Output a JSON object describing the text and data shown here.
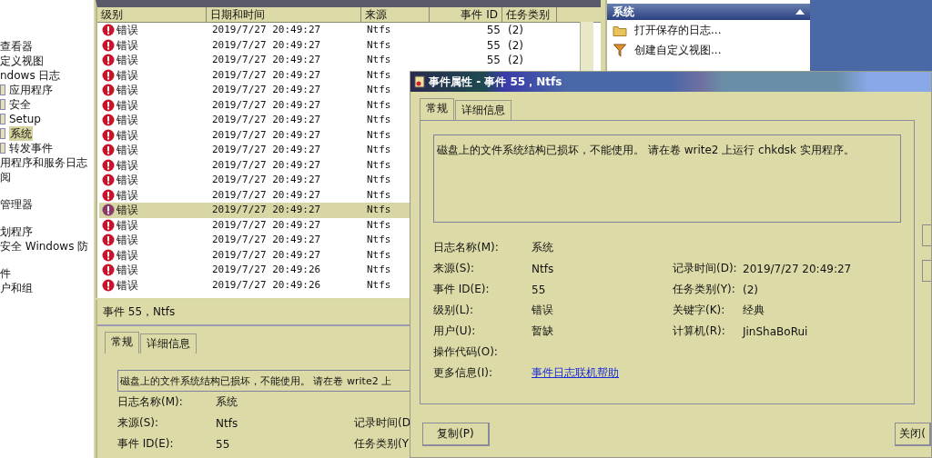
{
  "tree": {
    "sections": [
      [
        {
          "label": "查看器",
          "selected": false
        },
        {
          "label": "定义视图",
          "selected": false
        },
        {
          "label": "ndows 日志",
          "selected": false,
          "children": [
            {
              "label": "应用程序",
              "selected": false
            },
            {
              "label": "安全",
              "selected": false
            },
            {
              "label": "Setup",
              "selected": false
            },
            {
              "label": "系统",
              "selected": true
            },
            {
              "label": "转发事件",
              "selected": false
            }
          ]
        },
        {
          "label": "用程序和服务日志",
          "selected": false
        },
        {
          "label": "阅",
          "selected": false
        }
      ],
      [
        {
          "label": "管理器",
          "selected": false
        }
      ],
      [
        {
          "label": "划程序",
          "selected": false
        },
        {
          "label": "安全 Windows 防",
          "selected": false
        }
      ],
      [
        {
          "label": "件",
          "selected": false
        },
        {
          "label": "户和组",
          "selected": false
        }
      ]
    ]
  },
  "event_list": {
    "columns": [
      "级别",
      "日期和时间",
      "来源",
      "事件 ID",
      "任务类别"
    ],
    "rows": [
      {
        "level": "错误",
        "datetime": "2019/7/27 20:49:27",
        "source": "Ntfs",
        "event_id": "55",
        "task": "(2)",
        "selected": false
      },
      {
        "level": "错误",
        "datetime": "2019/7/27 20:49:27",
        "source": "Ntfs",
        "event_id": "55",
        "task": "(2)",
        "selected": false
      },
      {
        "level": "错误",
        "datetime": "2019/7/27 20:49:27",
        "source": "Ntfs",
        "event_id": "55",
        "task": "(2)",
        "selected": false
      },
      {
        "level": "错误",
        "datetime": "2019/7/27 20:49:27",
        "source": "Ntfs",
        "selected": false
      },
      {
        "level": "错误",
        "datetime": "2019/7/27 20:49:27",
        "source": "Ntfs",
        "selected": false
      },
      {
        "level": "错误",
        "datetime": "2019/7/27 20:49:27",
        "source": "Ntfs",
        "selected": false
      },
      {
        "level": "错误",
        "datetime": "2019/7/27 20:49:27",
        "source": "Ntfs",
        "selected": false
      },
      {
        "level": "错误",
        "datetime": "2019/7/27 20:49:27",
        "source": "Ntfs",
        "selected": false
      },
      {
        "level": "错误",
        "datetime": "2019/7/27 20:49:27",
        "source": "Ntfs",
        "selected": false
      },
      {
        "level": "错误",
        "datetime": "2019/7/27 20:49:27",
        "source": "Ntfs",
        "selected": false
      },
      {
        "level": "错误",
        "datetime": "2019/7/27 20:49:27",
        "source": "Ntfs",
        "selected": false
      },
      {
        "level": "错误",
        "datetime": "2019/7/27 20:49:27",
        "source": "Ntfs",
        "selected": false
      },
      {
        "level": "错误",
        "datetime": "2019/7/27 20:49:27",
        "source": "Ntfs",
        "selected": true
      },
      {
        "level": "错误",
        "datetime": "2019/7/27 20:49:27",
        "source": "Ntfs",
        "selected": false
      },
      {
        "level": "错误",
        "datetime": "2019/7/27 20:49:27",
        "source": "Ntfs",
        "selected": false
      },
      {
        "level": "错误",
        "datetime": "2019/7/27 20:49:27",
        "source": "Ntfs",
        "selected": false
      },
      {
        "level": "错误",
        "datetime": "2019/7/27 20:49:26",
        "source": "Ntfs",
        "selected": false
      },
      {
        "level": "错误",
        "datetime": "2019/7/27 20:49:26",
        "source": "Ntfs",
        "selected": false
      }
    ]
  },
  "actions": {
    "title": "系统",
    "items": [
      {
        "label": "打开保存的日志...",
        "kind": "folder"
      },
      {
        "label": "创建自定义视图...",
        "kind": "filter"
      }
    ]
  },
  "preview": {
    "title": "事件 55，Ntfs",
    "tabs": [
      {
        "label": "常规",
        "selected": true
      },
      {
        "label": "详细信息",
        "selected": false
      }
    ],
    "message": "磁盘上的文件系统结构已损坏，不能使用。 请在卷 write2 上",
    "fields": [
      {
        "label": "日志名称(M):",
        "value": "系统"
      },
      {
        "label": "来源(S):",
        "value": "Ntfs",
        "label2": "记录时间(D"
      },
      {
        "label": "事件 ID(E):",
        "value": "55",
        "label2": "任务类别(Y"
      }
    ]
  },
  "dialog": {
    "title": "事件属性 - 事件 55，Ntfs",
    "tabs": [
      {
        "label": "常规",
        "selected": true
      },
      {
        "label": "详细信息",
        "selected": false
      }
    ],
    "message": "磁盘上的文件系统结构已损坏，不能使用。 请在卷 write2 上运行 chkdsk 实用程序。",
    "fields": [
      {
        "label": "日志名称(M):",
        "value": "系统"
      },
      {
        "label": "来源(S):",
        "value": "Ntfs",
        "label2": "记录时间(D):",
        "value2": "2019/7/27 20:49:27"
      },
      {
        "label": "事件 ID(E):",
        "value": "55",
        "label2": "任务类别(Y):",
        "value2": "(2)"
      },
      {
        "label": "级别(L):",
        "value": "错误",
        "label2": "关键字(K):",
        "value2": "经典"
      },
      {
        "label": "用户(U):",
        "value": "暂缺",
        "label2": "计算机(R):",
        "value2": "JinShaBoRui"
      },
      {
        "label": "操作代码(O):"
      },
      {
        "label": "更多信息(I):",
        "link": "事件日志联机帮助"
      }
    ],
    "buttons": [
      "复制(P)",
      "关闭("
    ]
  }
}
